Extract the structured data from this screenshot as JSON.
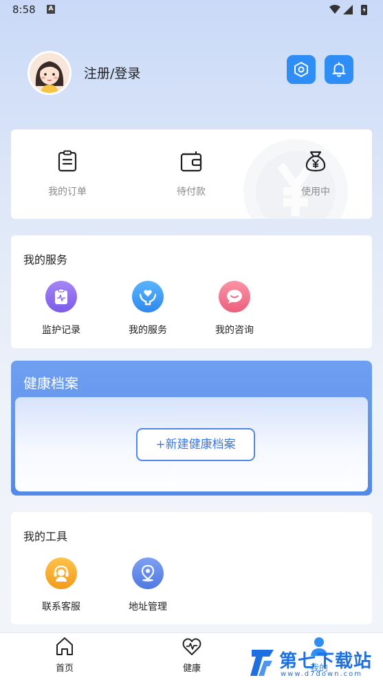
{
  "status_bar": {
    "time": "8:58",
    "notification_icon": "A"
  },
  "header": {
    "login_label": "注册/登录",
    "settings_icon": "settings-hexagon-icon",
    "bell_icon": "bell-icon",
    "accent_color": "#2f8ef5"
  },
  "orders": {
    "items": [
      {
        "label": "我的订单",
        "icon": "clipboard-icon"
      },
      {
        "label": "待付款",
        "icon": "wallet-icon"
      },
      {
        "label": "使用中",
        "icon": "money-bag-icon"
      }
    ]
  },
  "services": {
    "title": "我的服务",
    "items": [
      {
        "label": "监护记录",
        "icon": "monitor-record-icon",
        "color": "#8b6cf0"
      },
      {
        "label": "我的服务",
        "icon": "care-heart-icon",
        "color": "#3a97f0"
      },
      {
        "label": "我的咨询",
        "icon": "chat-bubble-icon",
        "color": "#ef6f88"
      }
    ]
  },
  "health_record": {
    "title": "健康档案",
    "new_button": "+新建健康档案"
  },
  "tools": {
    "title": "我的工具",
    "items": [
      {
        "label": "联系客服",
        "icon": "customer-service-icon",
        "color": "#f7a32a"
      },
      {
        "label": "地址管理",
        "icon": "location-pin-icon",
        "color": "#5b86ea"
      }
    ]
  },
  "tabbar": {
    "tabs": [
      {
        "label": "首页",
        "icon": "home-icon"
      },
      {
        "label": "健康",
        "icon": "heart-pulse-icon"
      },
      {
        "label": "我的",
        "icon": "user-icon"
      }
    ]
  },
  "watermark": {
    "brand": "第七下载站",
    "url": "www.d7down.com"
  }
}
